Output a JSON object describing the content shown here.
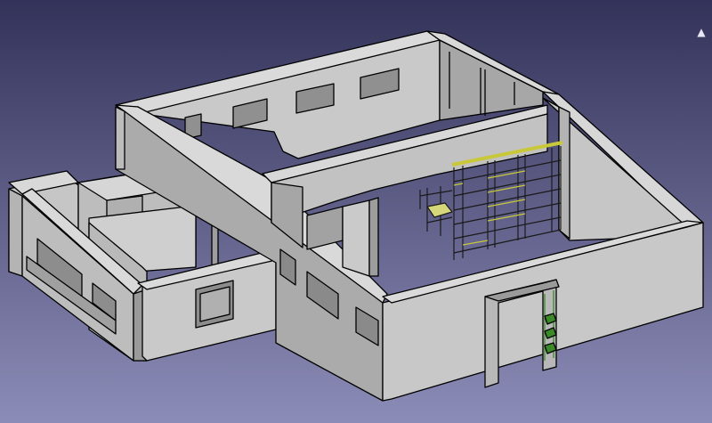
{
  "viewport": {
    "background_top": "#33335a",
    "background_bottom": "#8c8cb8"
  },
  "model": {
    "wall_top_color": "#dcdcdc",
    "wall_light_color": "#c2c2c2",
    "wall_mid_color": "#a9a9a9",
    "wall_dark_color": "#8d8d8d",
    "edge_color": "#000000",
    "shelf_accent_color": "#e8e84a",
    "ladder_accent_color": "#3a8a28"
  },
  "overlay": {
    "nav_cube_icon": "triangle-up-icon"
  }
}
